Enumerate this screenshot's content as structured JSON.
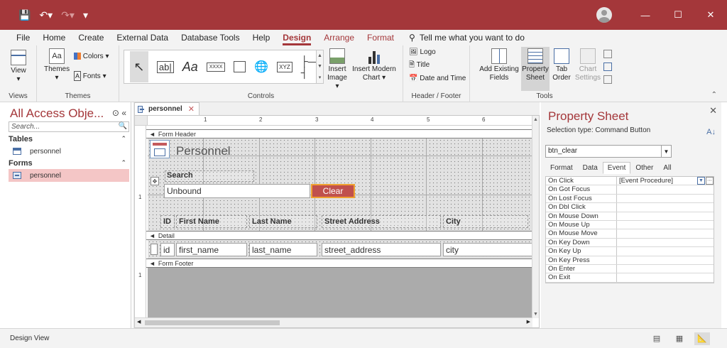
{
  "menu": {
    "tabs": [
      "File",
      "Home",
      "Create",
      "External Data",
      "Database Tools",
      "Help"
    ],
    "context_tabs": [
      "Design",
      "Arrange",
      "Format"
    ],
    "active_tab": "Design",
    "tell_me": "Tell me what you want to do"
  },
  "ribbon": {
    "views": {
      "view_label": "View",
      "group": "Views"
    },
    "themes": {
      "themes_label": "Themes",
      "colors_label": "Colors",
      "fonts_label": "Fonts",
      "group": "Themes"
    },
    "controls": {
      "xyz_label": "XYZ",
      "textbox_label": "ab|",
      "xxxx_label": "XXXX",
      "insert_image_label": "Insert Image",
      "insert_chart_label": "Insert Modern Chart",
      "group": "Controls"
    },
    "header_footer": {
      "logo_label": "Logo",
      "title_label": "Title",
      "datetime_label": "Date and Time",
      "group": "Header / Footer"
    },
    "tools": {
      "add_fields_label": "Add Existing Fields",
      "property_sheet_label": "Property Sheet",
      "tab_order_label": "Tab Order",
      "chart_settings_label": "Chart Settings",
      "group": "Tools"
    }
  },
  "nav": {
    "title": "All Access Obje...",
    "search_placeholder": "Search...",
    "categories": [
      {
        "name": "Tables",
        "items": [
          "personnel"
        ]
      },
      {
        "name": "Forms",
        "items": [
          "personnel"
        ]
      }
    ]
  },
  "document": {
    "tab_label": "personnel",
    "ruler_numbers": [
      "1",
      "2",
      "3",
      "4",
      "5",
      "6"
    ],
    "vruler_numbers": [
      "1",
      "1"
    ],
    "form_header_label": "Form Header",
    "detail_label": "Detail",
    "form_footer_label": "Form Footer",
    "form_title": "Personnel",
    "search_label": "Search",
    "unbound_text": "Unbound",
    "clear_button": "Clear",
    "header_labels": [
      "ID",
      "First Name",
      "Last Name",
      "Street Address",
      "City"
    ],
    "detail_fields": [
      "id",
      "first_name",
      "last_name",
      "street_address",
      "city"
    ]
  },
  "property_sheet": {
    "title": "Property Sheet",
    "selection_type": "Selection type:  Command Button",
    "selected_control": "btn_clear",
    "tabs": [
      "Format",
      "Data",
      "Event",
      "Other",
      "All"
    ],
    "active_tab": "Event",
    "properties": [
      {
        "name": "On Click",
        "value": "[Event Procedure]"
      },
      {
        "name": "On Got Focus",
        "value": ""
      },
      {
        "name": "On Lost Focus",
        "value": ""
      },
      {
        "name": "On Dbl Click",
        "value": ""
      },
      {
        "name": "On Mouse Down",
        "value": ""
      },
      {
        "name": "On Mouse Up",
        "value": ""
      },
      {
        "name": "On Mouse Move",
        "value": ""
      },
      {
        "name": "On Key Down",
        "value": ""
      },
      {
        "name": "On Key Up",
        "value": ""
      },
      {
        "name": "On Key Press",
        "value": ""
      },
      {
        "name": "On Enter",
        "value": ""
      },
      {
        "name": "On Exit",
        "value": ""
      }
    ]
  },
  "status": {
    "text": "Design View"
  },
  "colors": {
    "accent": "#a4373a",
    "button_fill": "#c0504d",
    "selection_border": "#f0a030"
  }
}
